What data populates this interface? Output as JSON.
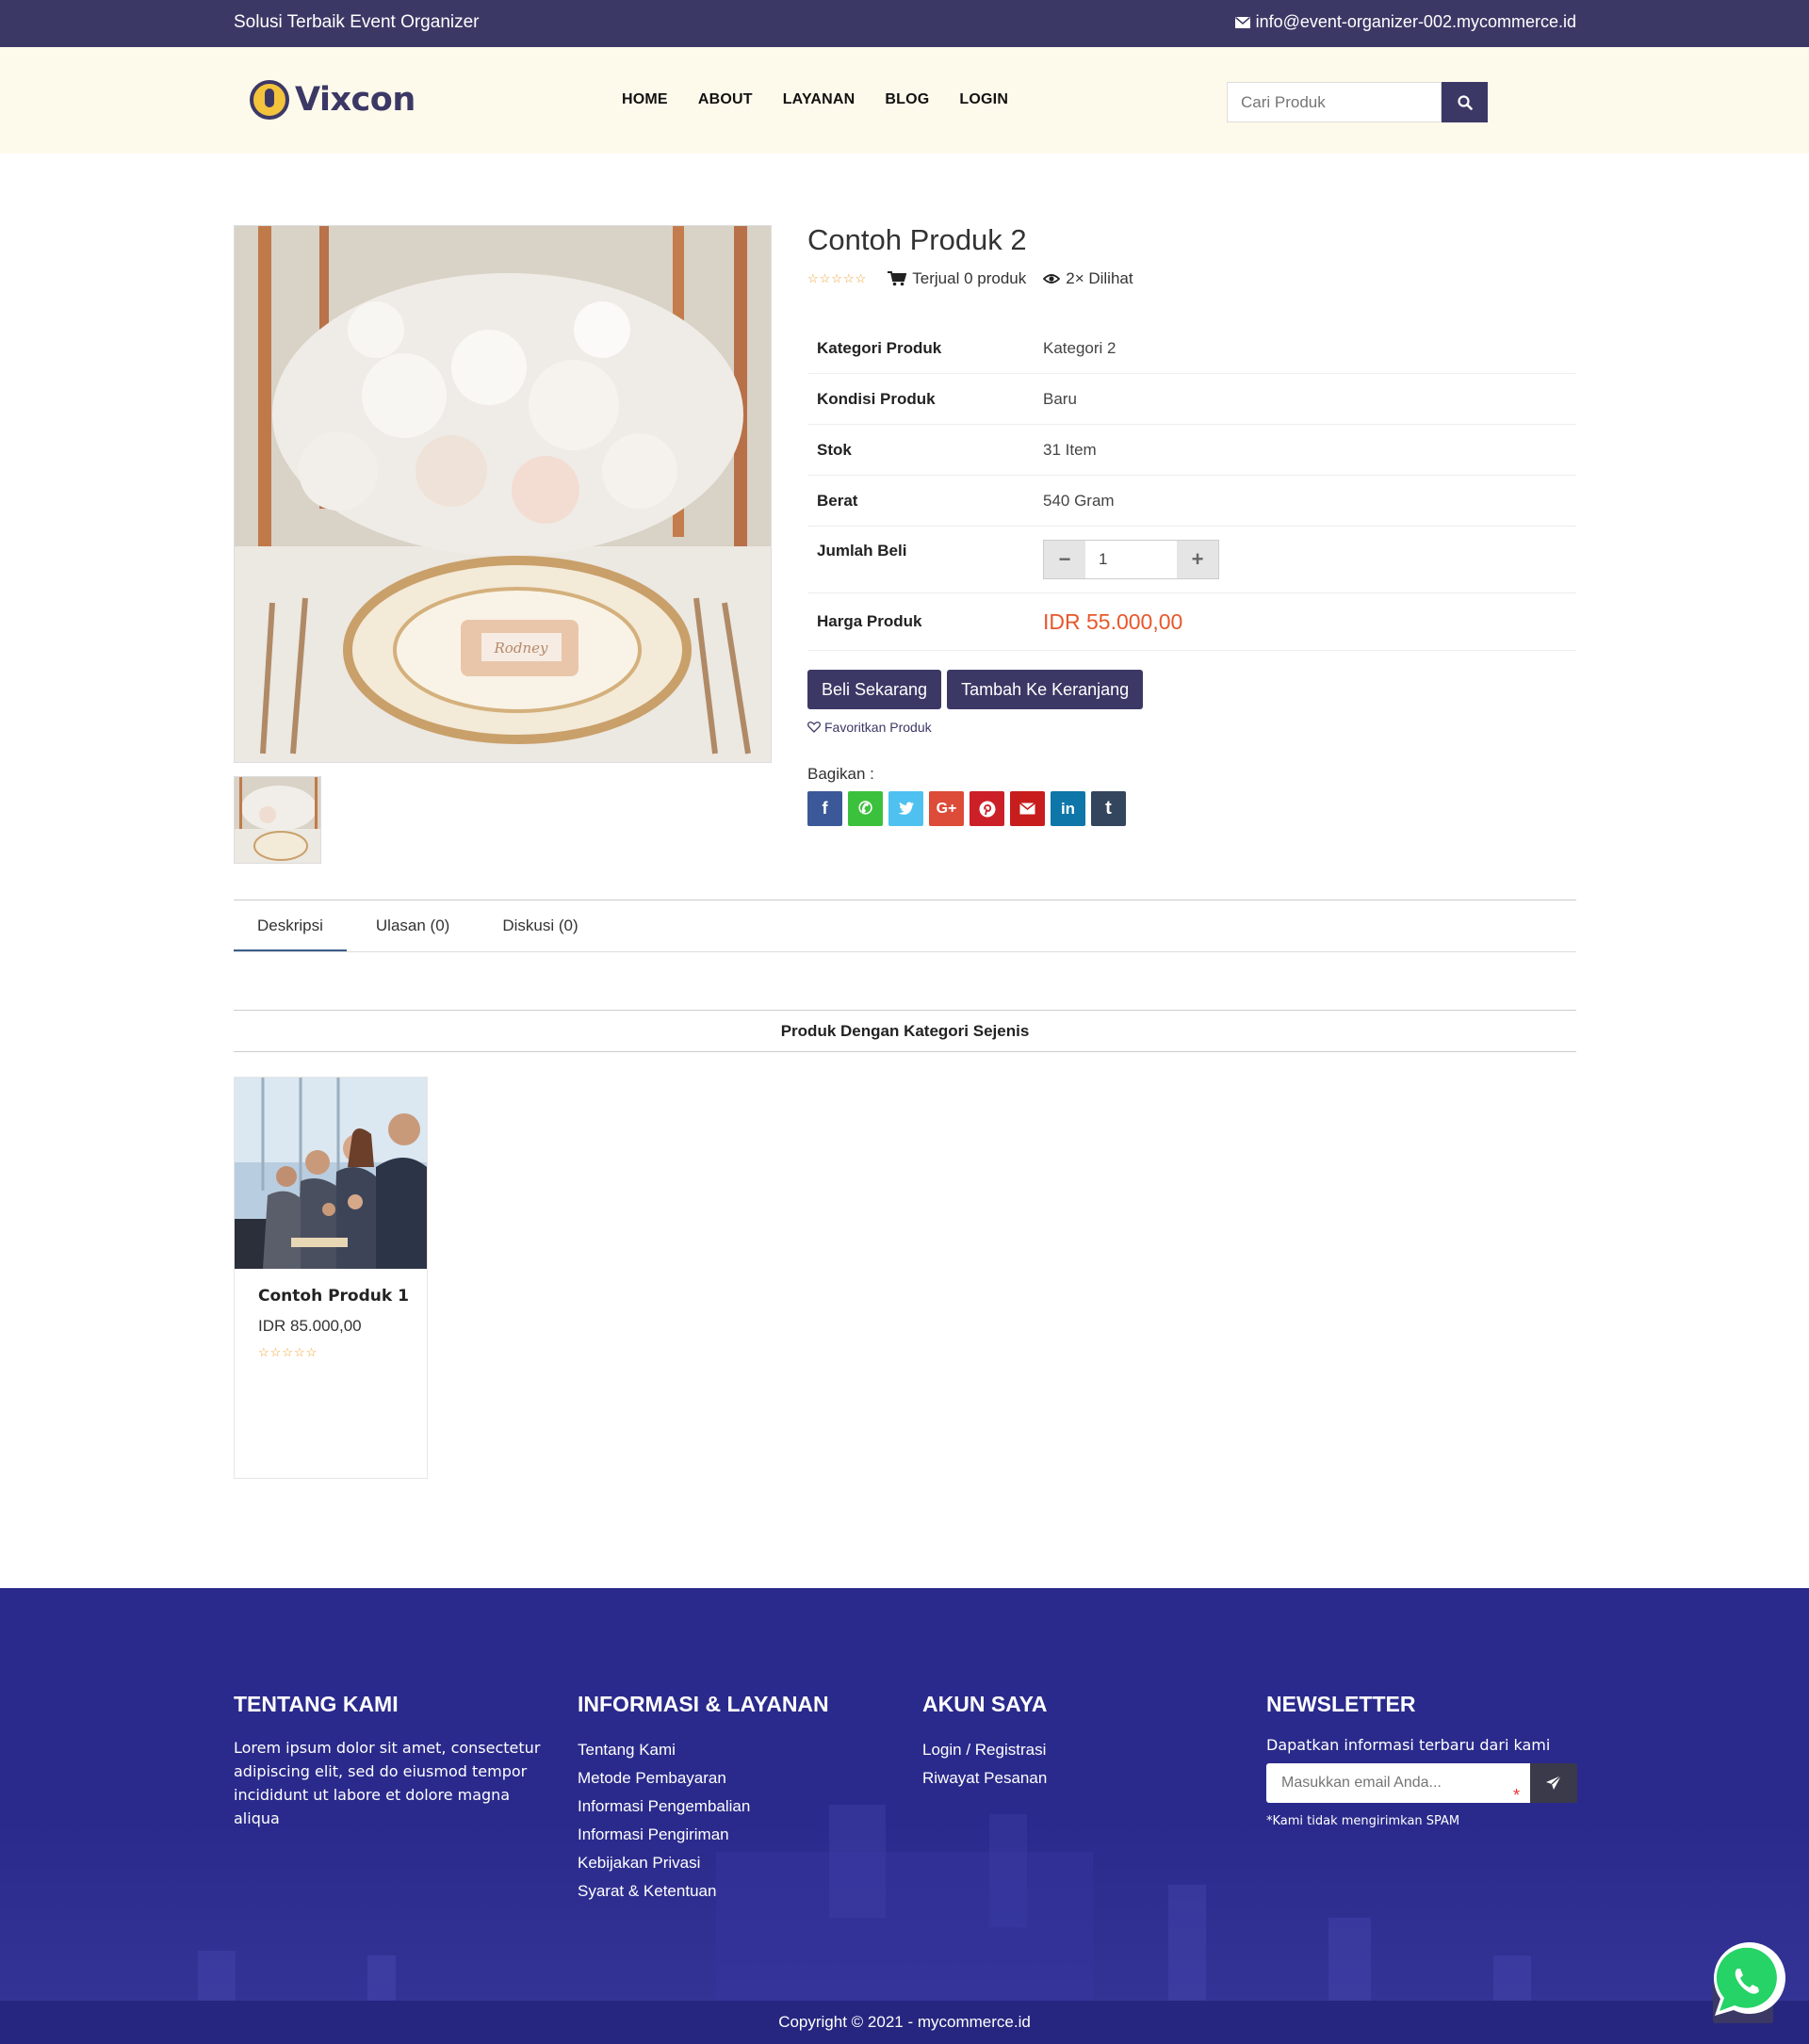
{
  "topbar": {
    "tagline": "Solusi Terbaik Event Organizer",
    "email": "info@event-organizer-002.mycommerce.id",
    "email_icon": "envelope-icon"
  },
  "header": {
    "brand": "Vixcon",
    "logo_icon": "microphone-icon",
    "nav": [
      "HOME",
      "ABOUT",
      "LAYANAN",
      "BLOG",
      "LOGIN"
    ],
    "search_placeholder": "Cari Produk",
    "search_icon": "search-icon"
  },
  "product": {
    "title": "Contoh Produk 2",
    "rating_stars": "☆☆☆☆☆",
    "sold": "Terjual 0 produk",
    "views": "2× Dilihat",
    "specs": [
      {
        "label": "Kategori Produk",
        "value": "Kategori 2"
      },
      {
        "label": "Kondisi Produk",
        "value": "Baru"
      },
      {
        "label": "Stok",
        "value": "31 Item"
      },
      {
        "label": "Berat",
        "value": "540 Gram"
      }
    ],
    "qty_label": "Jumlah Beli",
    "qty_value": "1",
    "qty_minus": "−",
    "qty_plus": "+",
    "price_label": "Harga Produk",
    "price": "IDR 55.000,00",
    "buy_now": "Beli Sekarang",
    "add_cart": "Tambah Ke Keranjang",
    "favorite": "Favoritkan Produk",
    "share_label": "Bagikan :",
    "share": [
      {
        "name": "facebook-icon",
        "glyph": "f",
        "color": "#3b5998"
      },
      {
        "name": "whatsapp-icon",
        "glyph": "✆",
        "color": "#3cc13c"
      },
      {
        "name": "twitter-icon",
        "glyph": "🐦",
        "color": "#4fc1f0"
      },
      {
        "name": "google-plus-icon",
        "glyph": "G+",
        "color": "#dd4b39"
      },
      {
        "name": "pinterest-icon",
        "glyph": "P",
        "color": "#cb2027"
      },
      {
        "name": "email-icon",
        "glyph": "✉",
        "color": "#c71d1d"
      },
      {
        "name": "linkedin-icon",
        "glyph": "in",
        "color": "#0e76a8"
      },
      {
        "name": "tumblr-icon",
        "glyph": "t",
        "color": "#34465d"
      }
    ]
  },
  "tabs": [
    "Deskripsi",
    "Ulasan (0)",
    "Diskusi (0)"
  ],
  "related": {
    "heading": "Produk Dengan Kategori Sejenis",
    "items": [
      {
        "name": "Contoh Produk 1",
        "price": "IDR 85.000,00",
        "stars": "☆☆☆☆☆"
      }
    ]
  },
  "footer": {
    "about_title": "TENTANG KAMI",
    "about_text": "Lorem ipsum dolor sit amet, consectetur adipiscing elit, sed do eiusmod tempor incididunt ut labore et dolore magna aliqua",
    "info_title": "INFORMASI & LAYANAN",
    "info_links": [
      "Tentang Kami",
      "Metode Pembayaran",
      "Informasi Pengembalian",
      "Informasi Pengiriman",
      "Kebijakan Privasi",
      "Syarat & Ketentuan"
    ],
    "account_title": "AKUN SAYA",
    "account_links": [
      "Login / Registrasi",
      "Riwayat Pesanan"
    ],
    "newsletter_title": "NEWSLETTER",
    "newsletter_desc": "Dapatkan informasi terbaru dari kami",
    "newsletter_placeholder": "Masukkan email Anda...",
    "newsletter_required": "*",
    "newsletter_note": "*Kami tidak mengirimkan SPAM",
    "copyright": "Copyright © 2021 - mycommerce.id"
  },
  "colors": {
    "brand": "#3c3866",
    "price": "#e8572c",
    "footer_bg": "#2a2a8c",
    "header_bg": "#fefaeb"
  }
}
